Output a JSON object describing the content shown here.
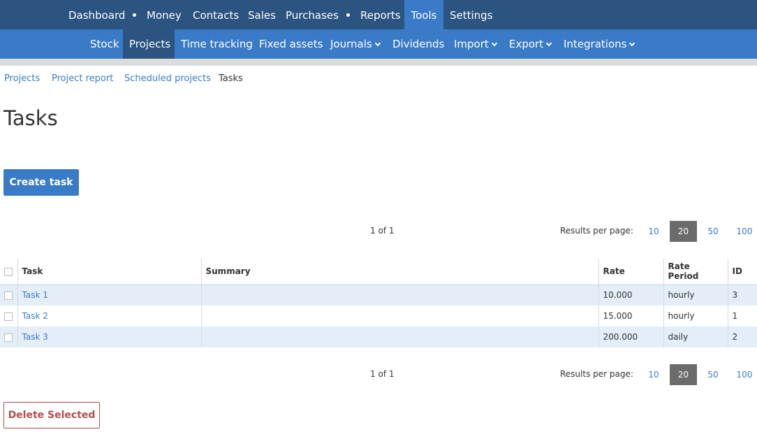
{
  "topnav": {
    "items": [
      "Dashboard",
      "Money",
      "Contacts",
      "Sales",
      "Purchases",
      "Reports",
      "Tools",
      "Settings"
    ],
    "active": "Tools"
  },
  "subnav": {
    "items": [
      "Stock",
      "Projects",
      "Time tracking",
      "Fixed assets",
      "Journals",
      "Dividends",
      "Import",
      "Export",
      "Integrations"
    ],
    "active": "Projects"
  },
  "tabs": [
    "Projects",
    "Project report",
    "Scheduled projects",
    "Tasks"
  ],
  "page_title": "Tasks",
  "create_button": "Create task",
  "pager": {
    "count": "1 of 1",
    "results_label": "Results per page:",
    "options": [
      "10",
      "20",
      "50",
      "100"
    ],
    "selected": "20"
  },
  "table": {
    "columns": [
      "Task",
      "Summary",
      "Rate",
      "Rate Period",
      "ID"
    ],
    "rows": [
      {
        "task": "Task 1",
        "summary": "",
        "rate": "10.000",
        "period": "hourly",
        "id": "3"
      },
      {
        "task": "Task 2",
        "summary": "",
        "rate": "15.000",
        "period": "hourly",
        "id": "1"
      },
      {
        "task": "Task 3",
        "summary": "",
        "rate": "200.000",
        "period": "daily",
        "id": "2"
      }
    ]
  },
  "delete_button": "Delete Selected",
  "colors": {
    "topnav_bg": "#2b5480",
    "subnav_bg": "#3a7bc8",
    "link": "#3a7bc8",
    "row_stripe": "#e4eef8",
    "danger": "#b54b4b"
  }
}
